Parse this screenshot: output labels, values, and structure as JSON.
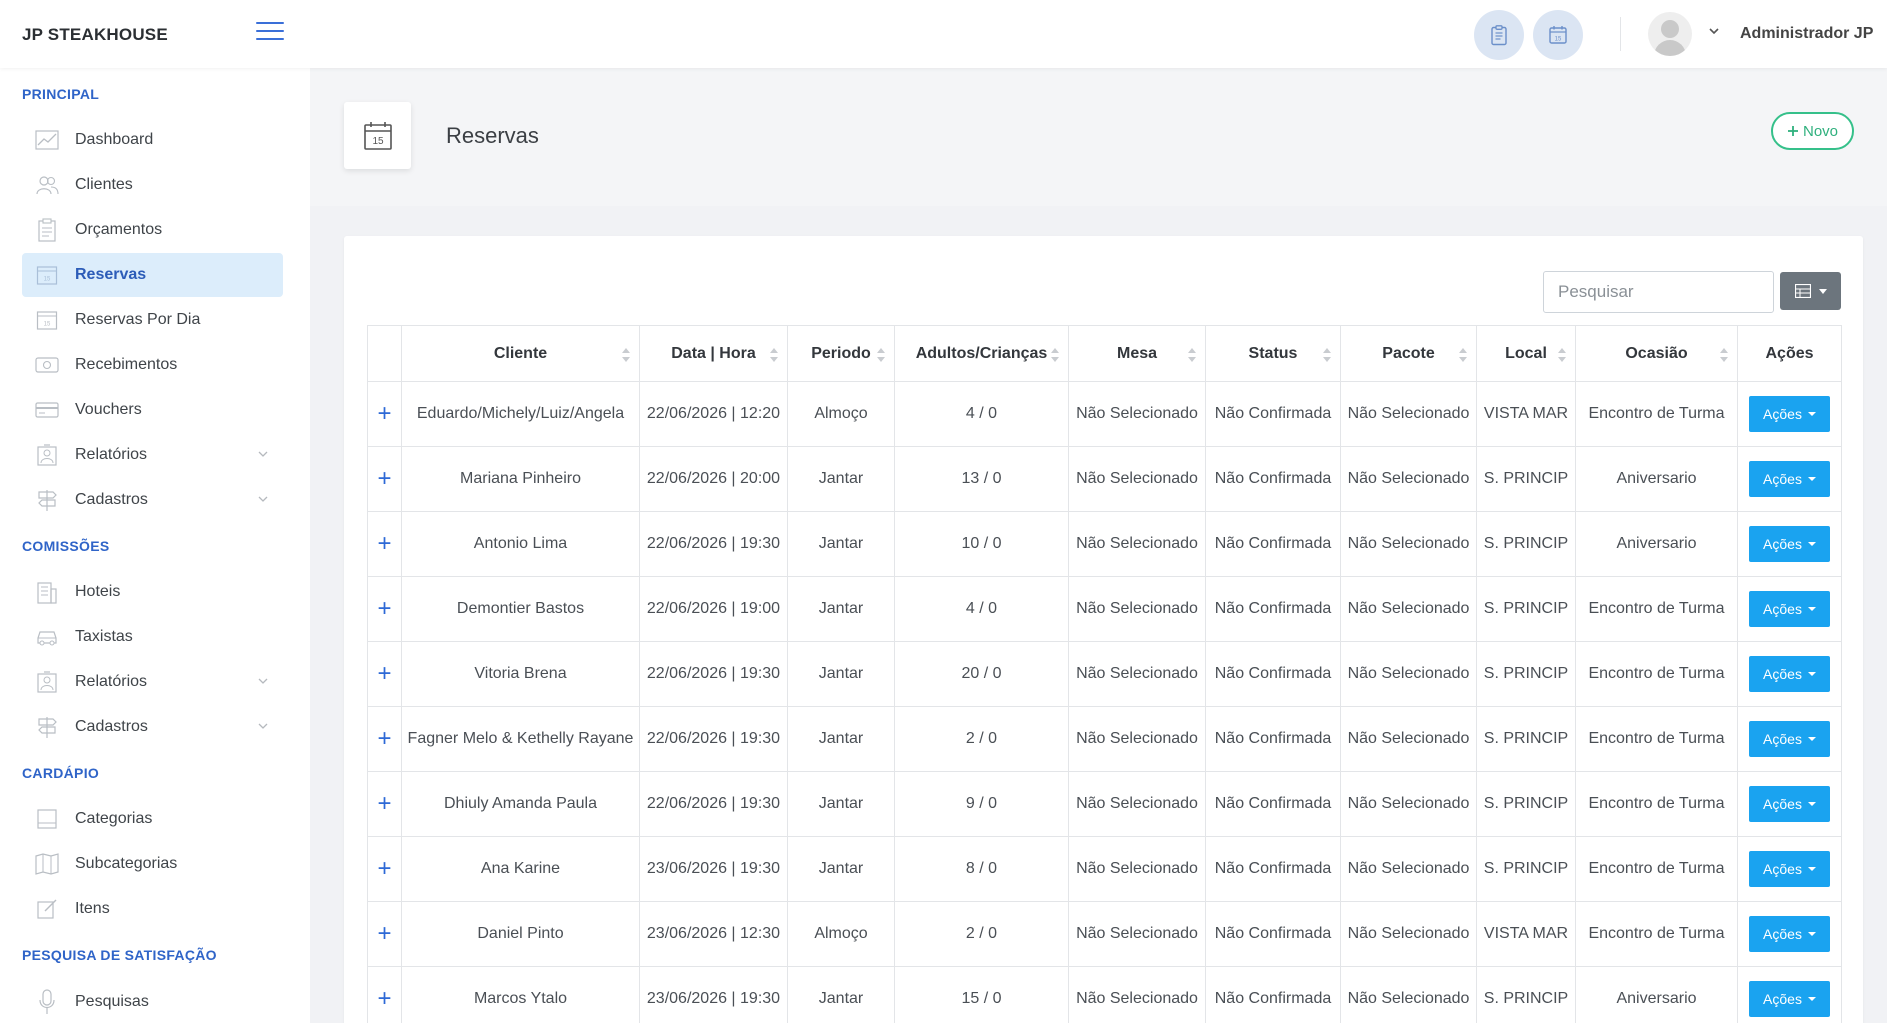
{
  "brand": "JP STEAKHOUSE",
  "user": {
    "name": "Administrador JP"
  },
  "top_icons": [
    "clipboard-icon",
    "calendar-icon"
  ],
  "sidebar": {
    "sections": [
      {
        "title": "PRINCIPAL",
        "items": [
          {
            "label": "Dashboard",
            "icon": "chart-line-icon"
          },
          {
            "label": "Clientes",
            "icon": "users-icon"
          },
          {
            "label": "Orçamentos",
            "icon": "clipboard-icon"
          },
          {
            "label": "Reservas",
            "icon": "calendar-icon",
            "active": true
          },
          {
            "label": "Reservas Por Dia",
            "icon": "calendar-icon"
          },
          {
            "label": "Recebimentos",
            "icon": "money-icon"
          },
          {
            "label": "Vouchers",
            "icon": "credit-card-icon"
          },
          {
            "label": "Relatórios",
            "icon": "report-icon",
            "expandable": true
          },
          {
            "label": "Cadastros",
            "icon": "signpost-icon",
            "expandable": true
          }
        ]
      },
      {
        "title": "COMISSÕES",
        "items": [
          {
            "label": "Hoteis",
            "icon": "building-icon"
          },
          {
            "label": "Taxistas",
            "icon": "car-icon"
          },
          {
            "label": "Relatórios",
            "icon": "report-icon",
            "expandable": true
          },
          {
            "label": "Cadastros",
            "icon": "signpost-icon",
            "expandable": true
          }
        ]
      },
      {
        "title": "CARDÁPIO",
        "items": [
          {
            "label": "Categorias",
            "icon": "layout-icon"
          },
          {
            "label": "Subcategorias",
            "icon": "map-icon"
          },
          {
            "label": "Itens",
            "icon": "edit-icon"
          }
        ]
      },
      {
        "title": "PESQUISA DE SATISFAÇÃO",
        "items": [
          {
            "label": "Pesquisas",
            "icon": "microphone-icon"
          }
        ]
      }
    ]
  },
  "page": {
    "title": "Reservas",
    "calendar_day": "15",
    "new_label": "Novo"
  },
  "search": {
    "placeholder": "Pesquisar"
  },
  "table": {
    "columns": [
      "Cliente",
      "Data | Hora",
      "Periodo",
      "Adultos/Crianças",
      "Mesa",
      "Status",
      "Pacote",
      "Local",
      "Ocasião",
      "Ações"
    ],
    "action_label": "Ações",
    "rows": [
      {
        "cliente": "Eduardo/Michely/Luiz/Angela",
        "data_hora": "22/06/2026 | 12:20",
        "periodo": "Almoço",
        "adultos_criancas": "4 / 0",
        "mesa": "Não Selecionado",
        "status": "Não Confirmada",
        "pacote": "Não Selecionado",
        "local": "VISTA MAR",
        "ocasiao": "Encontro de Turma"
      },
      {
        "cliente": "Mariana Pinheiro",
        "data_hora": "22/06/2026 | 20:00",
        "periodo": "Jantar",
        "adultos_criancas": "13 / 0",
        "mesa": "Não Selecionado",
        "status": "Não Confirmada",
        "pacote": "Não Selecionado",
        "local": "S. PRINCIP",
        "ocasiao": "Aniversario"
      },
      {
        "cliente": "Antonio Lima",
        "data_hora": "22/06/2026 | 19:30",
        "periodo": "Jantar",
        "adultos_criancas": "10 / 0",
        "mesa": "Não Selecionado",
        "status": "Não Confirmada",
        "pacote": "Não Selecionado",
        "local": "S. PRINCIP",
        "ocasiao": "Aniversario"
      },
      {
        "cliente": "Demontier Bastos",
        "data_hora": "22/06/2026 | 19:00",
        "periodo": "Jantar",
        "adultos_criancas": "4 / 0",
        "mesa": "Não Selecionado",
        "status": "Não Confirmada",
        "pacote": "Não Selecionado",
        "local": "S. PRINCIP",
        "ocasiao": "Encontro de Turma"
      },
      {
        "cliente": "Vitoria Brena",
        "data_hora": "22/06/2026 | 19:30",
        "periodo": "Jantar",
        "adultos_criancas": "20 / 0",
        "mesa": "Não Selecionado",
        "status": "Não Confirmada",
        "pacote": "Não Selecionado",
        "local": "S. PRINCIP",
        "ocasiao": "Encontro de Turma"
      },
      {
        "cliente": "Fagner Melo & Kethelly Rayane",
        "data_hora": "22/06/2026 | 19:30",
        "periodo": "Jantar",
        "adultos_criancas": "2 / 0",
        "mesa": "Não Selecionado",
        "status": "Não Confirmada",
        "pacote": "Não Selecionado",
        "local": "S. PRINCIP",
        "ocasiao": "Encontro de Turma"
      },
      {
        "cliente": "Dhiuly Amanda Paula",
        "data_hora": "22/06/2026 | 19:30",
        "periodo": "Jantar",
        "adultos_criancas": "9 / 0",
        "mesa": "Não Selecionado",
        "status": "Não Confirmada",
        "pacote": "Não Selecionado",
        "local": "S. PRINCIP",
        "ocasiao": "Encontro de Turma"
      },
      {
        "cliente": "Ana Karine",
        "data_hora": "23/06/2026 | 19:30",
        "periodo": "Jantar",
        "adultos_criancas": "8 / 0",
        "mesa": "Não Selecionado",
        "status": "Não Confirmada",
        "pacote": "Não Selecionado",
        "local": "S. PRINCIP",
        "ocasiao": "Encontro de Turma"
      },
      {
        "cliente": "Daniel Pinto",
        "data_hora": "23/06/2026 | 12:30",
        "periodo": "Almoço",
        "adultos_criancas": "2 / 0",
        "mesa": "Não Selecionado",
        "status": "Não Confirmada",
        "pacote": "Não Selecionado",
        "local": "VISTA MAR",
        "ocasiao": "Encontro de Turma"
      },
      {
        "cliente": "Marcos Ytalo",
        "data_hora": "23/06/2026 | 19:30",
        "periodo": "Jantar",
        "adultos_criancas": "15 / 0",
        "mesa": "Não Selecionado",
        "status": "Não Confirmada",
        "pacote": "Não Selecionado",
        "local": "S. PRINCIP",
        "ocasiao": "Aniversario"
      }
    ]
  }
}
